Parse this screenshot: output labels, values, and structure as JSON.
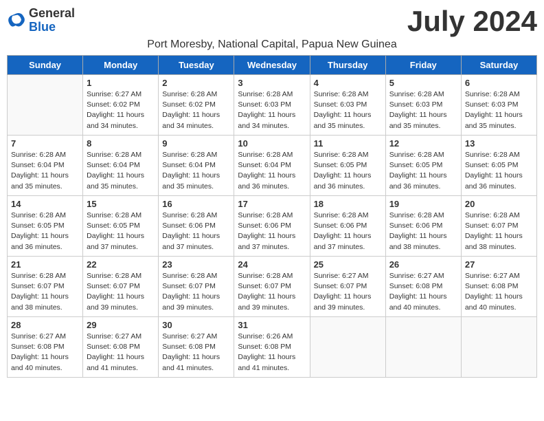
{
  "header": {
    "logo_line1": "General",
    "logo_line2": "Blue",
    "month_title": "July 2024",
    "location": "Port Moresby, National Capital, Papua New Guinea"
  },
  "weekdays": [
    "Sunday",
    "Monday",
    "Tuesday",
    "Wednesday",
    "Thursday",
    "Friday",
    "Saturday"
  ],
  "weeks": [
    [
      {
        "day": "",
        "info": ""
      },
      {
        "day": "1",
        "info": "Sunrise: 6:27 AM\nSunset: 6:02 PM\nDaylight: 11 hours\nand 34 minutes."
      },
      {
        "day": "2",
        "info": "Sunrise: 6:28 AM\nSunset: 6:02 PM\nDaylight: 11 hours\nand 34 minutes."
      },
      {
        "day": "3",
        "info": "Sunrise: 6:28 AM\nSunset: 6:03 PM\nDaylight: 11 hours\nand 34 minutes."
      },
      {
        "day": "4",
        "info": "Sunrise: 6:28 AM\nSunset: 6:03 PM\nDaylight: 11 hours\nand 35 minutes."
      },
      {
        "day": "5",
        "info": "Sunrise: 6:28 AM\nSunset: 6:03 PM\nDaylight: 11 hours\nand 35 minutes."
      },
      {
        "day": "6",
        "info": "Sunrise: 6:28 AM\nSunset: 6:03 PM\nDaylight: 11 hours\nand 35 minutes."
      }
    ],
    [
      {
        "day": "7",
        "info": "Sunrise: 6:28 AM\nSunset: 6:04 PM\nDaylight: 11 hours\nand 35 minutes."
      },
      {
        "day": "8",
        "info": "Sunrise: 6:28 AM\nSunset: 6:04 PM\nDaylight: 11 hours\nand 35 minutes."
      },
      {
        "day": "9",
        "info": "Sunrise: 6:28 AM\nSunset: 6:04 PM\nDaylight: 11 hours\nand 35 minutes."
      },
      {
        "day": "10",
        "info": "Sunrise: 6:28 AM\nSunset: 6:04 PM\nDaylight: 11 hours\nand 36 minutes."
      },
      {
        "day": "11",
        "info": "Sunrise: 6:28 AM\nSunset: 6:05 PM\nDaylight: 11 hours\nand 36 minutes."
      },
      {
        "day": "12",
        "info": "Sunrise: 6:28 AM\nSunset: 6:05 PM\nDaylight: 11 hours\nand 36 minutes."
      },
      {
        "day": "13",
        "info": "Sunrise: 6:28 AM\nSunset: 6:05 PM\nDaylight: 11 hours\nand 36 minutes."
      }
    ],
    [
      {
        "day": "14",
        "info": "Sunrise: 6:28 AM\nSunset: 6:05 PM\nDaylight: 11 hours\nand 36 minutes."
      },
      {
        "day": "15",
        "info": "Sunrise: 6:28 AM\nSunset: 6:05 PM\nDaylight: 11 hours\nand 37 minutes."
      },
      {
        "day": "16",
        "info": "Sunrise: 6:28 AM\nSunset: 6:06 PM\nDaylight: 11 hours\nand 37 minutes."
      },
      {
        "day": "17",
        "info": "Sunrise: 6:28 AM\nSunset: 6:06 PM\nDaylight: 11 hours\nand 37 minutes."
      },
      {
        "day": "18",
        "info": "Sunrise: 6:28 AM\nSunset: 6:06 PM\nDaylight: 11 hours\nand 37 minutes."
      },
      {
        "day": "19",
        "info": "Sunrise: 6:28 AM\nSunset: 6:06 PM\nDaylight: 11 hours\nand 38 minutes."
      },
      {
        "day": "20",
        "info": "Sunrise: 6:28 AM\nSunset: 6:07 PM\nDaylight: 11 hours\nand 38 minutes."
      }
    ],
    [
      {
        "day": "21",
        "info": "Sunrise: 6:28 AM\nSunset: 6:07 PM\nDaylight: 11 hours\nand 38 minutes."
      },
      {
        "day": "22",
        "info": "Sunrise: 6:28 AM\nSunset: 6:07 PM\nDaylight: 11 hours\nand 39 minutes."
      },
      {
        "day": "23",
        "info": "Sunrise: 6:28 AM\nSunset: 6:07 PM\nDaylight: 11 hours\nand 39 minutes."
      },
      {
        "day": "24",
        "info": "Sunrise: 6:28 AM\nSunset: 6:07 PM\nDaylight: 11 hours\nand 39 minutes."
      },
      {
        "day": "25",
        "info": "Sunrise: 6:27 AM\nSunset: 6:07 PM\nDaylight: 11 hours\nand 39 minutes."
      },
      {
        "day": "26",
        "info": "Sunrise: 6:27 AM\nSunset: 6:08 PM\nDaylight: 11 hours\nand 40 minutes."
      },
      {
        "day": "27",
        "info": "Sunrise: 6:27 AM\nSunset: 6:08 PM\nDaylight: 11 hours\nand 40 minutes."
      }
    ],
    [
      {
        "day": "28",
        "info": "Sunrise: 6:27 AM\nSunset: 6:08 PM\nDaylight: 11 hours\nand 40 minutes."
      },
      {
        "day": "29",
        "info": "Sunrise: 6:27 AM\nSunset: 6:08 PM\nDaylight: 11 hours\nand 41 minutes."
      },
      {
        "day": "30",
        "info": "Sunrise: 6:27 AM\nSunset: 6:08 PM\nDaylight: 11 hours\nand 41 minutes."
      },
      {
        "day": "31",
        "info": "Sunrise: 6:26 AM\nSunset: 6:08 PM\nDaylight: 11 hours\nand 41 minutes."
      },
      {
        "day": "",
        "info": ""
      },
      {
        "day": "",
        "info": ""
      },
      {
        "day": "",
        "info": ""
      }
    ]
  ]
}
